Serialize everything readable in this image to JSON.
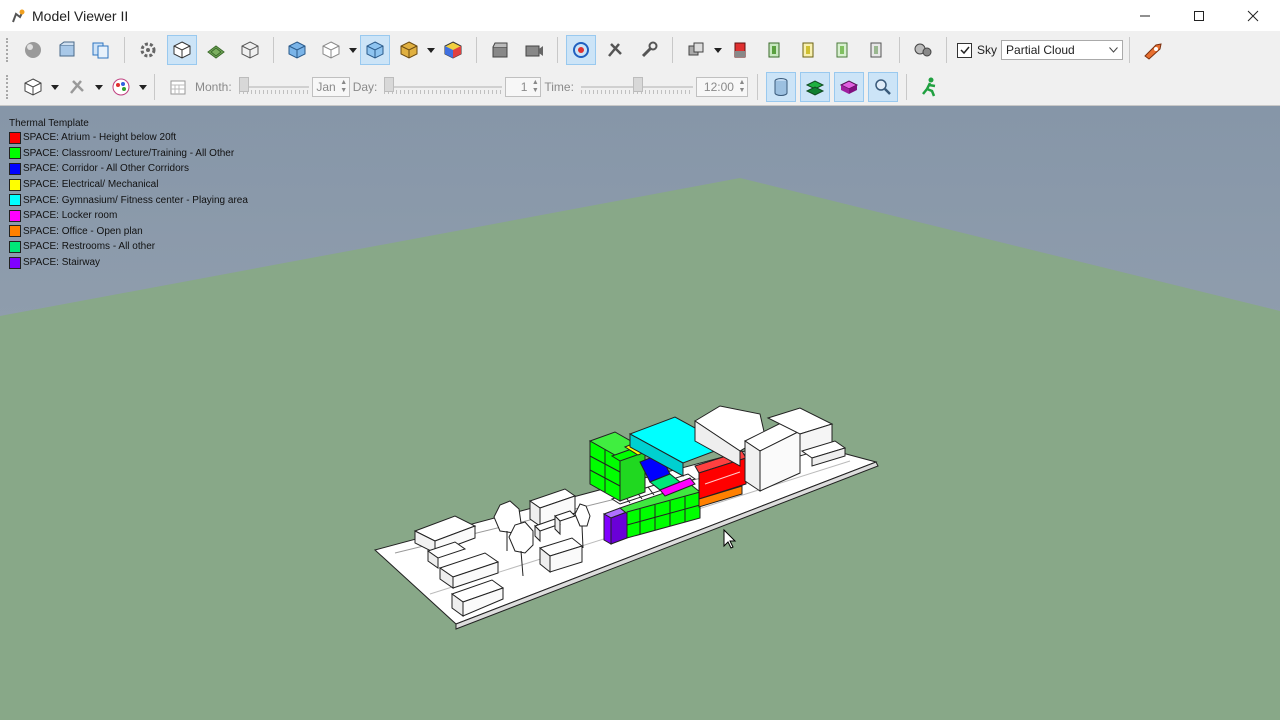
{
  "window": {
    "title": "Model Viewer II"
  },
  "toolbar": {
    "sky_label": "Sky",
    "sky_checked": true,
    "sky_value": "Partial Cloud",
    "month_label": "Month:",
    "month_value": "Jan",
    "day_label": "Day:",
    "day_value": "1",
    "time_label": "Time:",
    "time_value": "12:00"
  },
  "legend": {
    "title": "Thermal Template",
    "items": [
      {
        "label": "SPACE: Atrium - Height below 20ft",
        "color": "#ff0000"
      },
      {
        "label": "SPACE: Classroom/ Lecture/Training - All Other",
        "color": "#00ff00"
      },
      {
        "label": "SPACE: Corridor - All Other Corridors",
        "color": "#0000ff"
      },
      {
        "label": "SPACE: Electrical/ Mechanical",
        "color": "#ffff00"
      },
      {
        "label": "SPACE: Gymnasium/ Fitness center - Playing area",
        "color": "#00ffff"
      },
      {
        "label": "SPACE: Locker room",
        "color": "#ff00ff"
      },
      {
        "label": "SPACE: Office - Open plan",
        "color": "#ff8000"
      },
      {
        "label": "SPACE: Restrooms - All other",
        "color": "#00e878"
      },
      {
        "label": "SPACE: Stairway",
        "color": "#8000ff"
      }
    ]
  }
}
